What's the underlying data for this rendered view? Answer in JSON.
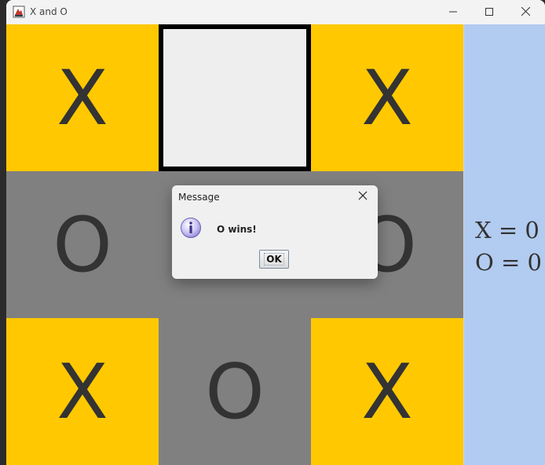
{
  "window": {
    "title": "X and O",
    "icons": {
      "app": "java-app-icon",
      "minimize": "minimize-icon",
      "maximize": "maximize-icon",
      "close": "close-icon"
    }
  },
  "board": {
    "cells": [
      {
        "mark": "X",
        "color": "#ffc800"
      },
      {
        "mark": "",
        "color": "#eeeeee"
      },
      {
        "mark": "X",
        "color": "#ffc800"
      },
      {
        "mark": "O",
        "color": "#808080"
      },
      {
        "mark": "",
        "color": "#808080"
      },
      {
        "mark": "O",
        "color": "#808080"
      },
      {
        "mark": "X",
        "color": "#ffc800"
      },
      {
        "mark": "O",
        "color": "#808080"
      },
      {
        "mark": "X",
        "color": "#ffc800"
      }
    ]
  },
  "score": {
    "x_line": "X = 0",
    "o_line": "O = 0",
    "panel_color": "#b2cbf0"
  },
  "dialog": {
    "title": "Message",
    "message": "O wins!",
    "ok_label": "OK",
    "icon": "info-icon"
  }
}
